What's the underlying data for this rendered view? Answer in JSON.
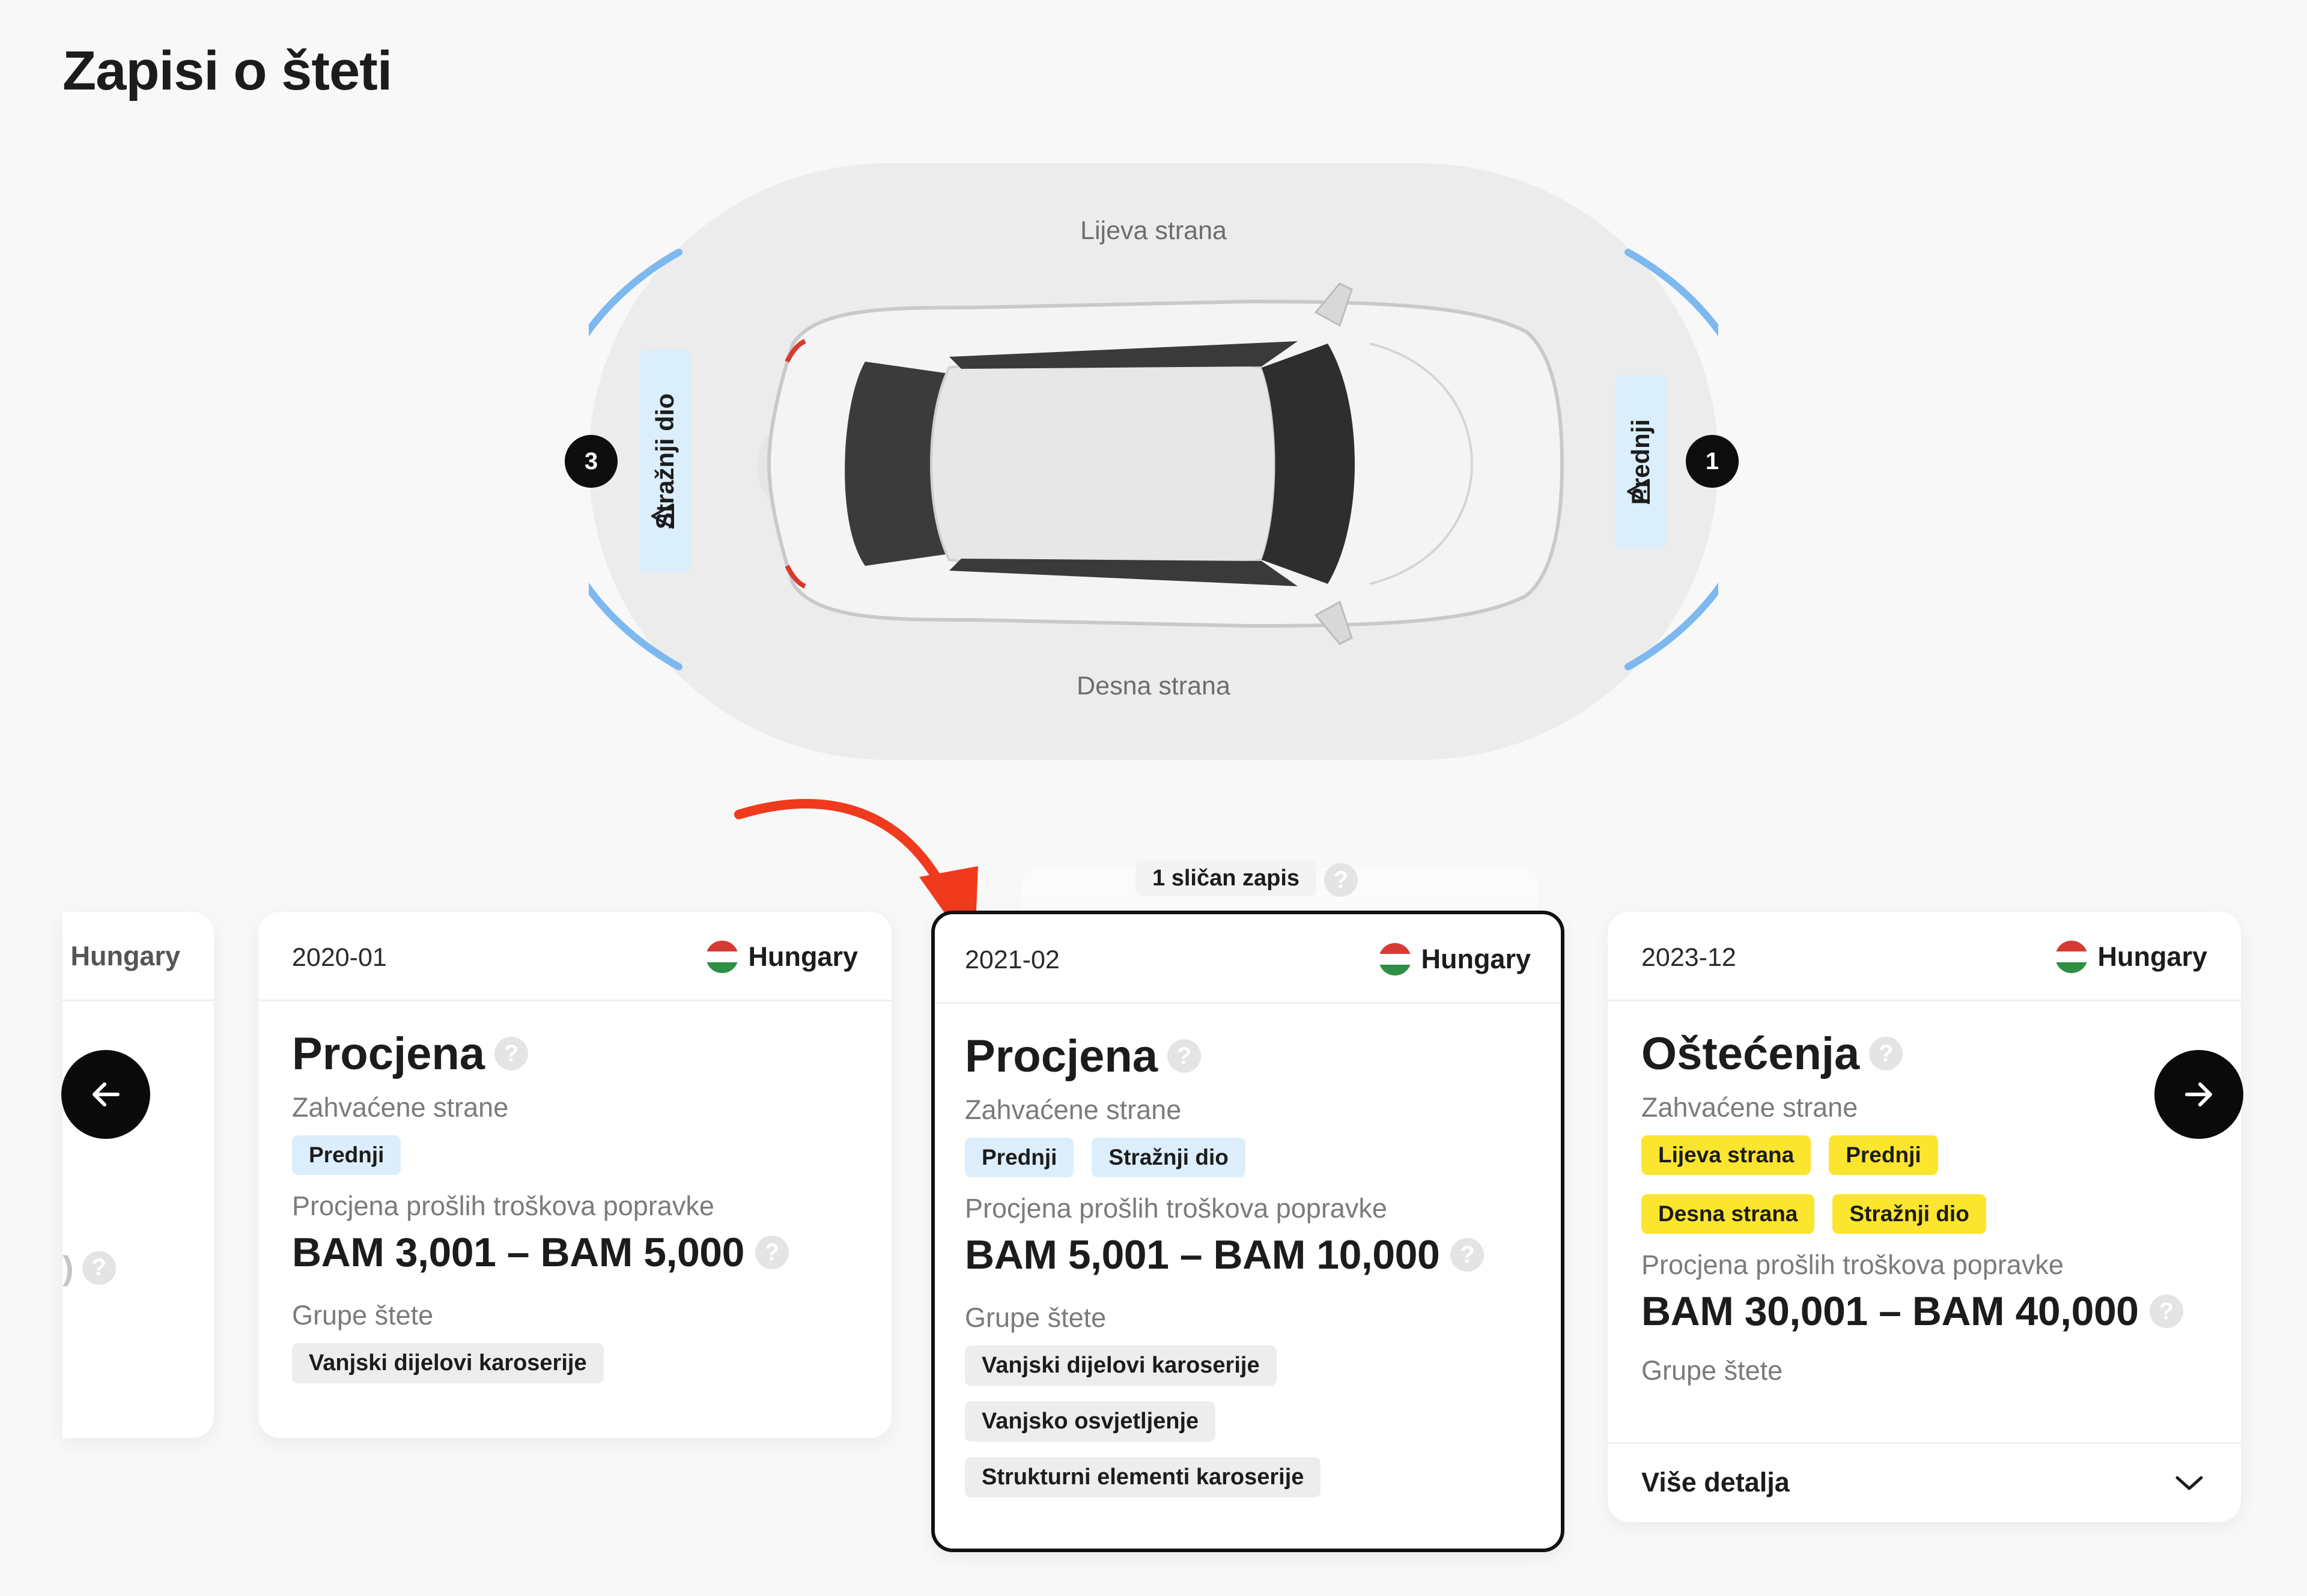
{
  "page": {
    "title": "Zapisi o šteti"
  },
  "diagram": {
    "left_label": "Lijeva strana",
    "right_label": "Desna strana",
    "rear_zone": {
      "label": "Stražnji dio",
      "count": "3"
    },
    "front_zone": {
      "label": "Prednji",
      "count": "1"
    }
  },
  "labels": {
    "affected_sides": "Zahvaćene strane",
    "repair_estimate": "Procjena prošlih troškova popravke",
    "damage_groups": "Grupe štete",
    "help": "?",
    "more_details": "Više detalja",
    "similar": "1 sličan zapis",
    "partial_price_tail": ")"
  },
  "records": [
    {
      "date": "",
      "country": "Hungary"
    },
    {
      "date": "2020-01",
      "country": "Hungary",
      "type": "Procjena",
      "sides": [
        "Prednji"
      ],
      "price": "BAM 3,001 – BAM 5,000",
      "groups": [
        "Vanjski dijelovi karoserije"
      ]
    },
    {
      "date": "2021-02",
      "country": "Hungary",
      "type": "Procjena",
      "sides": [
        "Prednji",
        "Stražnji dio"
      ],
      "price": "BAM 5,001 – BAM 10,000",
      "groups": [
        "Vanjski dijelovi karoserije",
        "Vanjsko osvjetljenje",
        "Strukturni elementi karoserije"
      ]
    },
    {
      "date": "2023-12",
      "country": "Hungary",
      "type": "Oštećenja",
      "sides": [
        "Lijeva strana",
        "Prednji",
        "Desna strana",
        "Stražnji dio"
      ],
      "price": "BAM 30,001 – BAM 40,000"
    }
  ],
  "colors": {
    "arc": "#7db8ef",
    "zone": "#dceefc",
    "highlight": "#fbe52e",
    "arrow": "#f03a1d"
  },
  "icons": [
    "warning-icon",
    "arrow-left-icon",
    "arrow-right-icon",
    "chevron-down-icon",
    "help-icon",
    "flag-hungary-icon",
    "curved-arrow-annotation-icon",
    "car-top-view-icon"
  ]
}
